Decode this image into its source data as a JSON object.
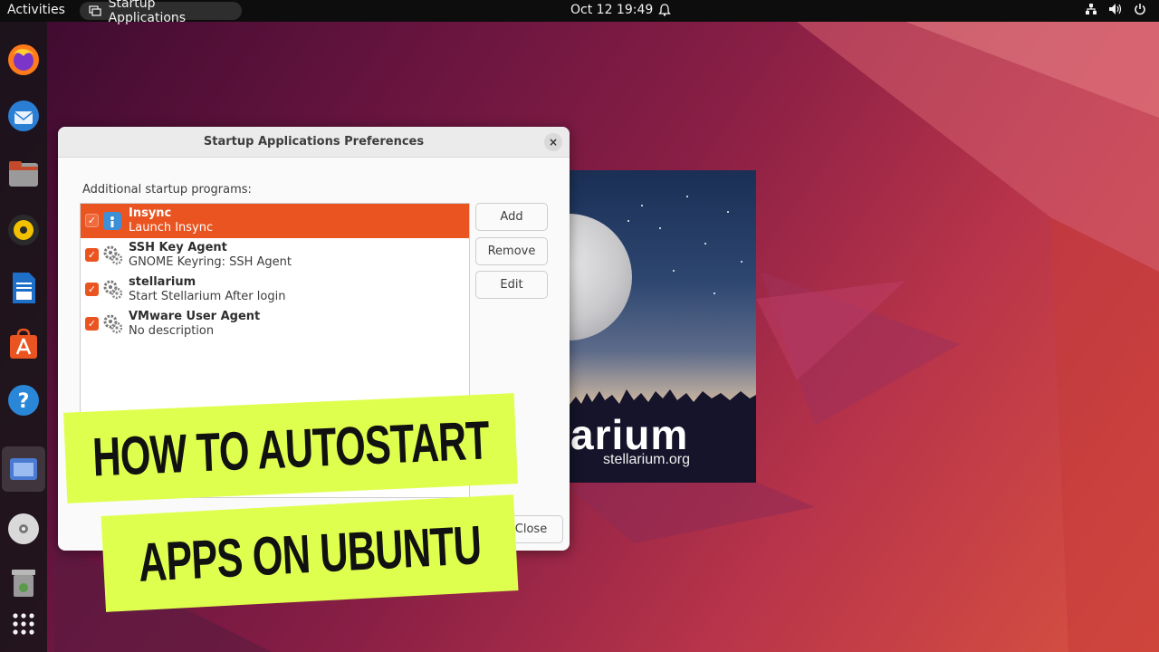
{
  "topbar": {
    "activities": "Activities",
    "app_name": "Startup Applications",
    "datetime": "Oct 12  19:49",
    "tray_icons": [
      "network-icon",
      "volume-icon",
      "power-icon"
    ]
  },
  "dock": {
    "apps": [
      "firefox",
      "thunderbird",
      "files",
      "rhythmbox",
      "libreoffice-writer",
      "ubuntu-software",
      "help",
      "startup-applications",
      "dvd-drive",
      "trash",
      "show-applications"
    ]
  },
  "splash": {
    "brand": "arium",
    "site": "stellarium.org"
  },
  "dialog": {
    "title": "Startup Applications Preferences",
    "close_glyph": "×",
    "section_label": "Additional startup programs:",
    "items": [
      {
        "name": "Insync",
        "description": "Launch Insync",
        "enabled": true,
        "selected": true,
        "icon": "insync-icon"
      },
      {
        "name": "SSH Key Agent",
        "description": "GNOME Keyring: SSH Agent",
        "enabled": true,
        "selected": false,
        "icon": "gears-icon"
      },
      {
        "name": "stellarium",
        "description": "Start Stellarium After login",
        "enabled": true,
        "selected": false,
        "icon": "gears-icon"
      },
      {
        "name": "VMware User Agent",
        "description": "No description",
        "enabled": true,
        "selected": false,
        "icon": "gears-icon"
      }
    ],
    "buttons": {
      "add": "Add",
      "remove": "Remove",
      "edit": "Edit",
      "close": "Close"
    }
  },
  "overlay": {
    "line1": "HOW TO AUTOSTART",
    "line2": "APPS ON UBUNTU"
  },
  "colors": {
    "accent": "#e95420",
    "banner": "#dfff4f",
    "topbar": "#0d0d0d"
  }
}
